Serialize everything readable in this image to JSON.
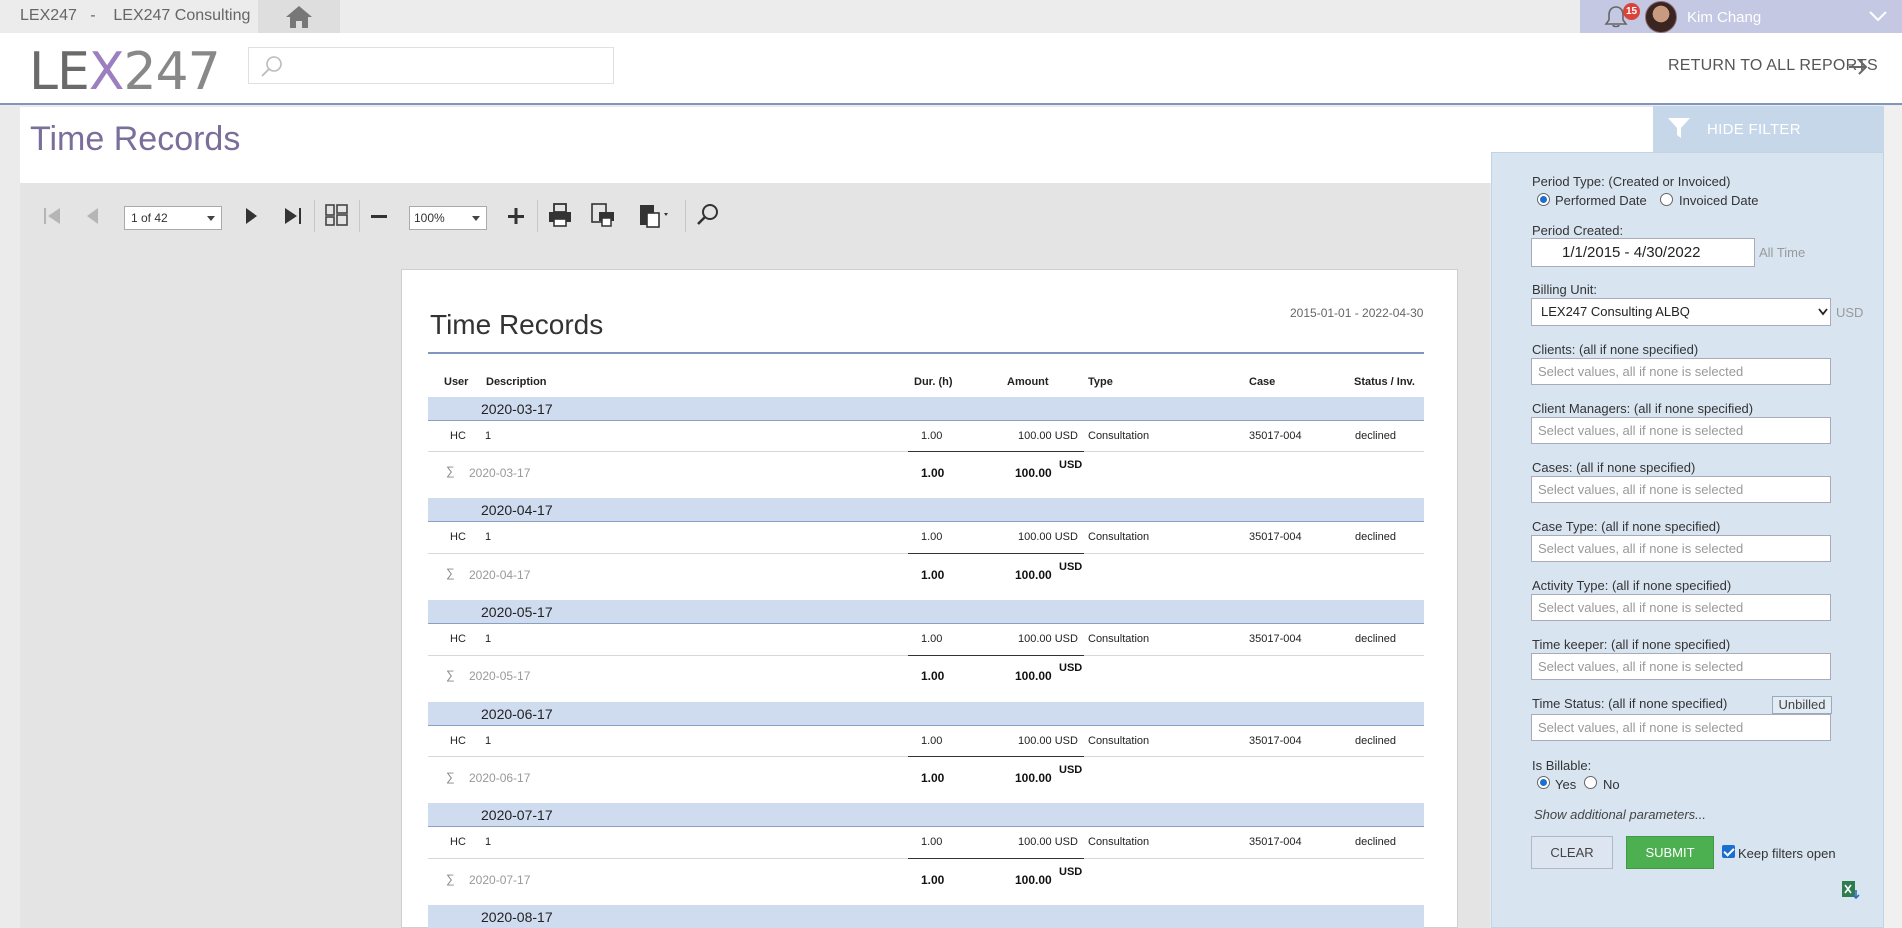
{
  "app": {
    "title": "LEX247   -    LEX247 Consulting",
    "logo": {
      "part1": "LE",
      "part2": "X",
      "part3": "247"
    },
    "notifications_count": "15",
    "user_name": "Kim Chang",
    "return_link": "RETURN TO ALL REPORTS",
    "search_placeholder": ""
  },
  "page": {
    "title": "Time Records"
  },
  "toolbar": {
    "page_indicator": "1 of 42",
    "zoom": "100%"
  },
  "report": {
    "title": "Time Records",
    "range": "2015-01-01 - 2022-04-30",
    "columns": {
      "user": "User",
      "description": "Description",
      "duration": "Dur. (h)",
      "amount": "Amount",
      "type": "Type",
      "case": "Case",
      "status": "Status / Inv."
    },
    "groups": [
      {
        "date": "2020-03-17",
        "row": {
          "user": "HC",
          "description": "1",
          "duration": "1.00",
          "amount": "100.00 USD",
          "type": "Consultation",
          "case": "35017-004",
          "status": "declined"
        },
        "sum": {
          "symbol": "∑",
          "label": "2020-03-17",
          "duration": "1.00",
          "amount": "100.00",
          "currency": "USD"
        }
      },
      {
        "date": "2020-04-17",
        "row": {
          "user": "HC",
          "description": "1",
          "duration": "1.00",
          "amount": "100.00 USD",
          "type": "Consultation",
          "case": "35017-004",
          "status": "declined"
        },
        "sum": {
          "symbol": "∑",
          "label": "2020-04-17",
          "duration": "1.00",
          "amount": "100.00",
          "currency": "USD"
        }
      },
      {
        "date": "2020-05-17",
        "row": {
          "user": "HC",
          "description": "1",
          "duration": "1.00",
          "amount": "100.00 USD",
          "type": "Consultation",
          "case": "35017-004",
          "status": "declined"
        },
        "sum": {
          "symbol": "∑",
          "label": "2020-05-17",
          "duration": "1.00",
          "amount": "100.00",
          "currency": "USD"
        }
      },
      {
        "date": "2020-06-17",
        "row": {
          "user": "HC",
          "description": "1",
          "duration": "1.00",
          "amount": "100.00 USD",
          "type": "Consultation",
          "case": "35017-004",
          "status": "declined"
        },
        "sum": {
          "symbol": "∑",
          "label": "2020-06-17",
          "duration": "1.00",
          "amount": "100.00",
          "currency": "USD"
        }
      },
      {
        "date": "2020-07-17",
        "row": {
          "user": "HC",
          "description": "1",
          "duration": "1.00",
          "amount": "100.00 USD",
          "type": "Consultation",
          "case": "35017-004",
          "status": "declined"
        },
        "sum": {
          "symbol": "∑",
          "label": "2020-07-17",
          "duration": "1.00",
          "amount": "100.00",
          "currency": "USD"
        }
      },
      {
        "date": "2020-08-17"
      }
    ]
  },
  "filter": {
    "hide_label": "HIDE FILTER",
    "period_type_label": "Period Type: (Created or Invoiced)",
    "performed_date": "Performed Date",
    "invoiced_date": "Invoiced Date",
    "period_created_label": "Period Created:",
    "period_value": "1/1/2015 - 4/30/2022",
    "all_time": "All Time",
    "billing_unit_label": "Billing Unit:",
    "billing_unit_value": "LEX247 Consulting ALBQ",
    "currency": "USD",
    "placeholder": "Select values, all if none is selected",
    "fields": [
      {
        "label": "Clients: (all if none specified)"
      },
      {
        "label": "Client Managers: (all if none specified)"
      },
      {
        "label": "Cases: (all if none specified)"
      },
      {
        "label": "Case Type: (all if none specified)"
      },
      {
        "label": "Activity Type: (all if none specified)"
      },
      {
        "label": "Time keeper: (all if none specified)"
      },
      {
        "label": "Time Status: (all if none specified)"
      }
    ],
    "unbilled_chip": "Unbilled",
    "is_billable_label": "Is Billable:",
    "yes": "Yes",
    "no": "No",
    "show_more": "Show additional parameters...",
    "clear": "CLEAR",
    "submit": "SUBMIT",
    "keep_open": "Keep filters open"
  }
}
